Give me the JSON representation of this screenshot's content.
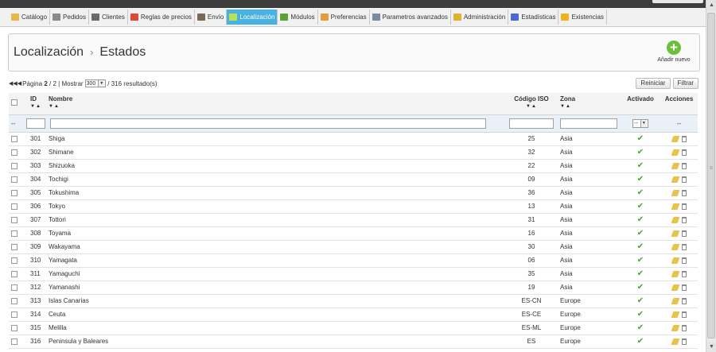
{
  "nav": {
    "items": [
      {
        "label": "Catálogo",
        "icon": "folder-icon",
        "color": "#e6b84a"
      },
      {
        "label": "Pedidos",
        "icon": "cart-icon",
        "color": "#8a8a8a"
      },
      {
        "label": "Clientes",
        "icon": "user-icon",
        "color": "#6a6a6a"
      },
      {
        "label": "Reglas de precios",
        "icon": "tag-icon",
        "color": "#d94a3a"
      },
      {
        "label": "Envío",
        "icon": "truck-icon",
        "color": "#7a6a55"
      },
      {
        "label": "Localización",
        "icon": "globe-icon",
        "color": "#b5e25a",
        "active": true
      },
      {
        "label": "Módulos",
        "icon": "puzzle-icon",
        "color": "#5ca03a"
      },
      {
        "label": "Preferencias",
        "icon": "window-icon",
        "color": "#e0a040"
      },
      {
        "label": "Parametros avanzados",
        "icon": "wrench-icon",
        "color": "#7a8aa5"
      },
      {
        "label": "Administración",
        "icon": "key-icon",
        "color": "#e0b030"
      },
      {
        "label": "Estadísticas",
        "icon": "bar-chart-icon",
        "color": "#4a6ad0"
      },
      {
        "label": "Existencias",
        "icon": "box-icon",
        "color": "#f0b020"
      }
    ]
  },
  "header": {
    "section": "Localización",
    "separator": "›",
    "page": "Estados",
    "add_label": "Añadir nuevo"
  },
  "pager": {
    "prefix": "Página",
    "current": "2",
    "total": "/ 2",
    "show_label": "| Mostrar",
    "per_page": "300",
    "results": "/ 316 resultado(s)"
  },
  "buttons": {
    "reset": "Reiniciar",
    "filter": "Filtrar"
  },
  "columns": {
    "id": "ID",
    "name": "Nombre",
    "iso": "Código ISO",
    "zone": "Zona",
    "active": "Activado",
    "actions": "Acciones",
    "sort": "▼▲"
  },
  "filters": {
    "dash": "--",
    "active_value": "--",
    "actions_value": "--"
  },
  "rows": [
    {
      "id": "301",
      "name": "Shiga",
      "iso": "25",
      "zone": "Asia"
    },
    {
      "id": "302",
      "name": "Shimane",
      "iso": "32",
      "zone": "Asia"
    },
    {
      "id": "303",
      "name": "Shizuoka",
      "iso": "22",
      "zone": "Asia"
    },
    {
      "id": "304",
      "name": "Tochigi",
      "iso": "09",
      "zone": "Asia"
    },
    {
      "id": "305",
      "name": "Tokushima",
      "iso": "36",
      "zone": "Asia"
    },
    {
      "id": "306",
      "name": "Tokyo",
      "iso": "13",
      "zone": "Asia"
    },
    {
      "id": "307",
      "name": "Tottori",
      "iso": "31",
      "zone": "Asia"
    },
    {
      "id": "308",
      "name": "Toyama",
      "iso": "16",
      "zone": "Asia"
    },
    {
      "id": "309",
      "name": "Wakayama",
      "iso": "30",
      "zone": "Asia"
    },
    {
      "id": "310",
      "name": "Yamagata",
      "iso": "06",
      "zone": "Asia"
    },
    {
      "id": "311",
      "name": "Yamaguchi",
      "iso": "35",
      "zone": "Asia"
    },
    {
      "id": "312",
      "name": "Yamanashi",
      "iso": "19",
      "zone": "Asia"
    },
    {
      "id": "313",
      "name": "Islas Canarias",
      "iso": "ES-CN",
      "zone": "Europe"
    },
    {
      "id": "314",
      "name": "Ceuta",
      "iso": "ES-CE",
      "zone": "Europe"
    },
    {
      "id": "315",
      "name": "Melilla",
      "iso": "ES-ML",
      "zone": "Europe"
    },
    {
      "id": "316",
      "name": "Peninsula y Baleares",
      "iso": "ES",
      "zone": "Europe"
    }
  ],
  "status": {
    "active_icon": "checkmark-icon",
    "active_color": "#4da330",
    "active_glyph": "✔"
  }
}
